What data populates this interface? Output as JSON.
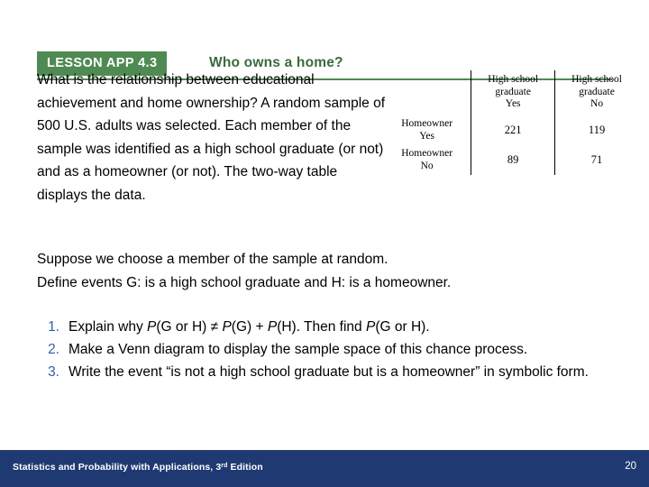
{
  "header": {
    "lesson_badge": "LESSON APP 4.3",
    "title": "Who owns a home?"
  },
  "intro": {
    "text": "What is the relationship between educational achievement and home ownership? A random sample of 500 U.S. adults was selected. Each member of the sample was identified as a high school graduate (or not) and as a homeowner (or not). The two-way table displays the data."
  },
  "table": {
    "corner_label": "",
    "col_headers": [
      "High school graduate Yes",
      "High school graduate No"
    ],
    "col_header_lines": [
      [
        "High school",
        "graduate",
        "Yes"
      ],
      [
        "High school",
        "graduate",
        "No"
      ]
    ],
    "row_headers": [
      [
        "Homeowner",
        "Yes"
      ],
      [
        "Homeowner",
        "No"
      ]
    ],
    "rows": [
      {
        "label": "Homeowner Yes",
        "values": [
          "221",
          "119"
        ]
      },
      {
        "label": "Homeowner No",
        "values": [
          "89",
          "71"
        ]
      }
    ]
  },
  "suppose": {
    "line1": "Suppose we choose a member of the sample at random.",
    "line2": "Define events G: is a high school graduate and H: is a homeowner."
  },
  "questions": [
    {
      "number": "1.",
      "parts": [
        {
          "t": "Explain why ",
          "style": "normal"
        },
        {
          "t": "P",
          "style": "italic"
        },
        {
          "t": "(G or H) ≠ ",
          "style": "normal"
        },
        {
          "t": "P",
          "style": "italic"
        },
        {
          "t": "(G) + ",
          "style": "normal"
        },
        {
          "t": "P",
          "style": "italic"
        },
        {
          "t": "(H). Then find ",
          "style": "normal"
        },
        {
          "t": "P",
          "style": "italic"
        },
        {
          "t": "(G or H).",
          "style": "normal"
        }
      ],
      "plain": "Explain why P(G or H) ≠ P(G) + P(H). Then find P(G or H)."
    },
    {
      "number": "2.",
      "plain": "Make a Venn diagram to display the sample space of this chance process."
    },
    {
      "number": "3.",
      "plain": "Write the event “is not a high school graduate but is a homeowner” in symbolic form."
    }
  ],
  "footer": {
    "source": "Statistics and Probability with Applications, 3",
    "source_sup": "rd",
    "source_tail": " Edition",
    "page_number": "20"
  },
  "colors": {
    "badge_green": "#4f8a52",
    "title_green": "#3a6b3d",
    "footer_blue": "#1f3a73",
    "list_number_blue": "#2f5fa8"
  }
}
